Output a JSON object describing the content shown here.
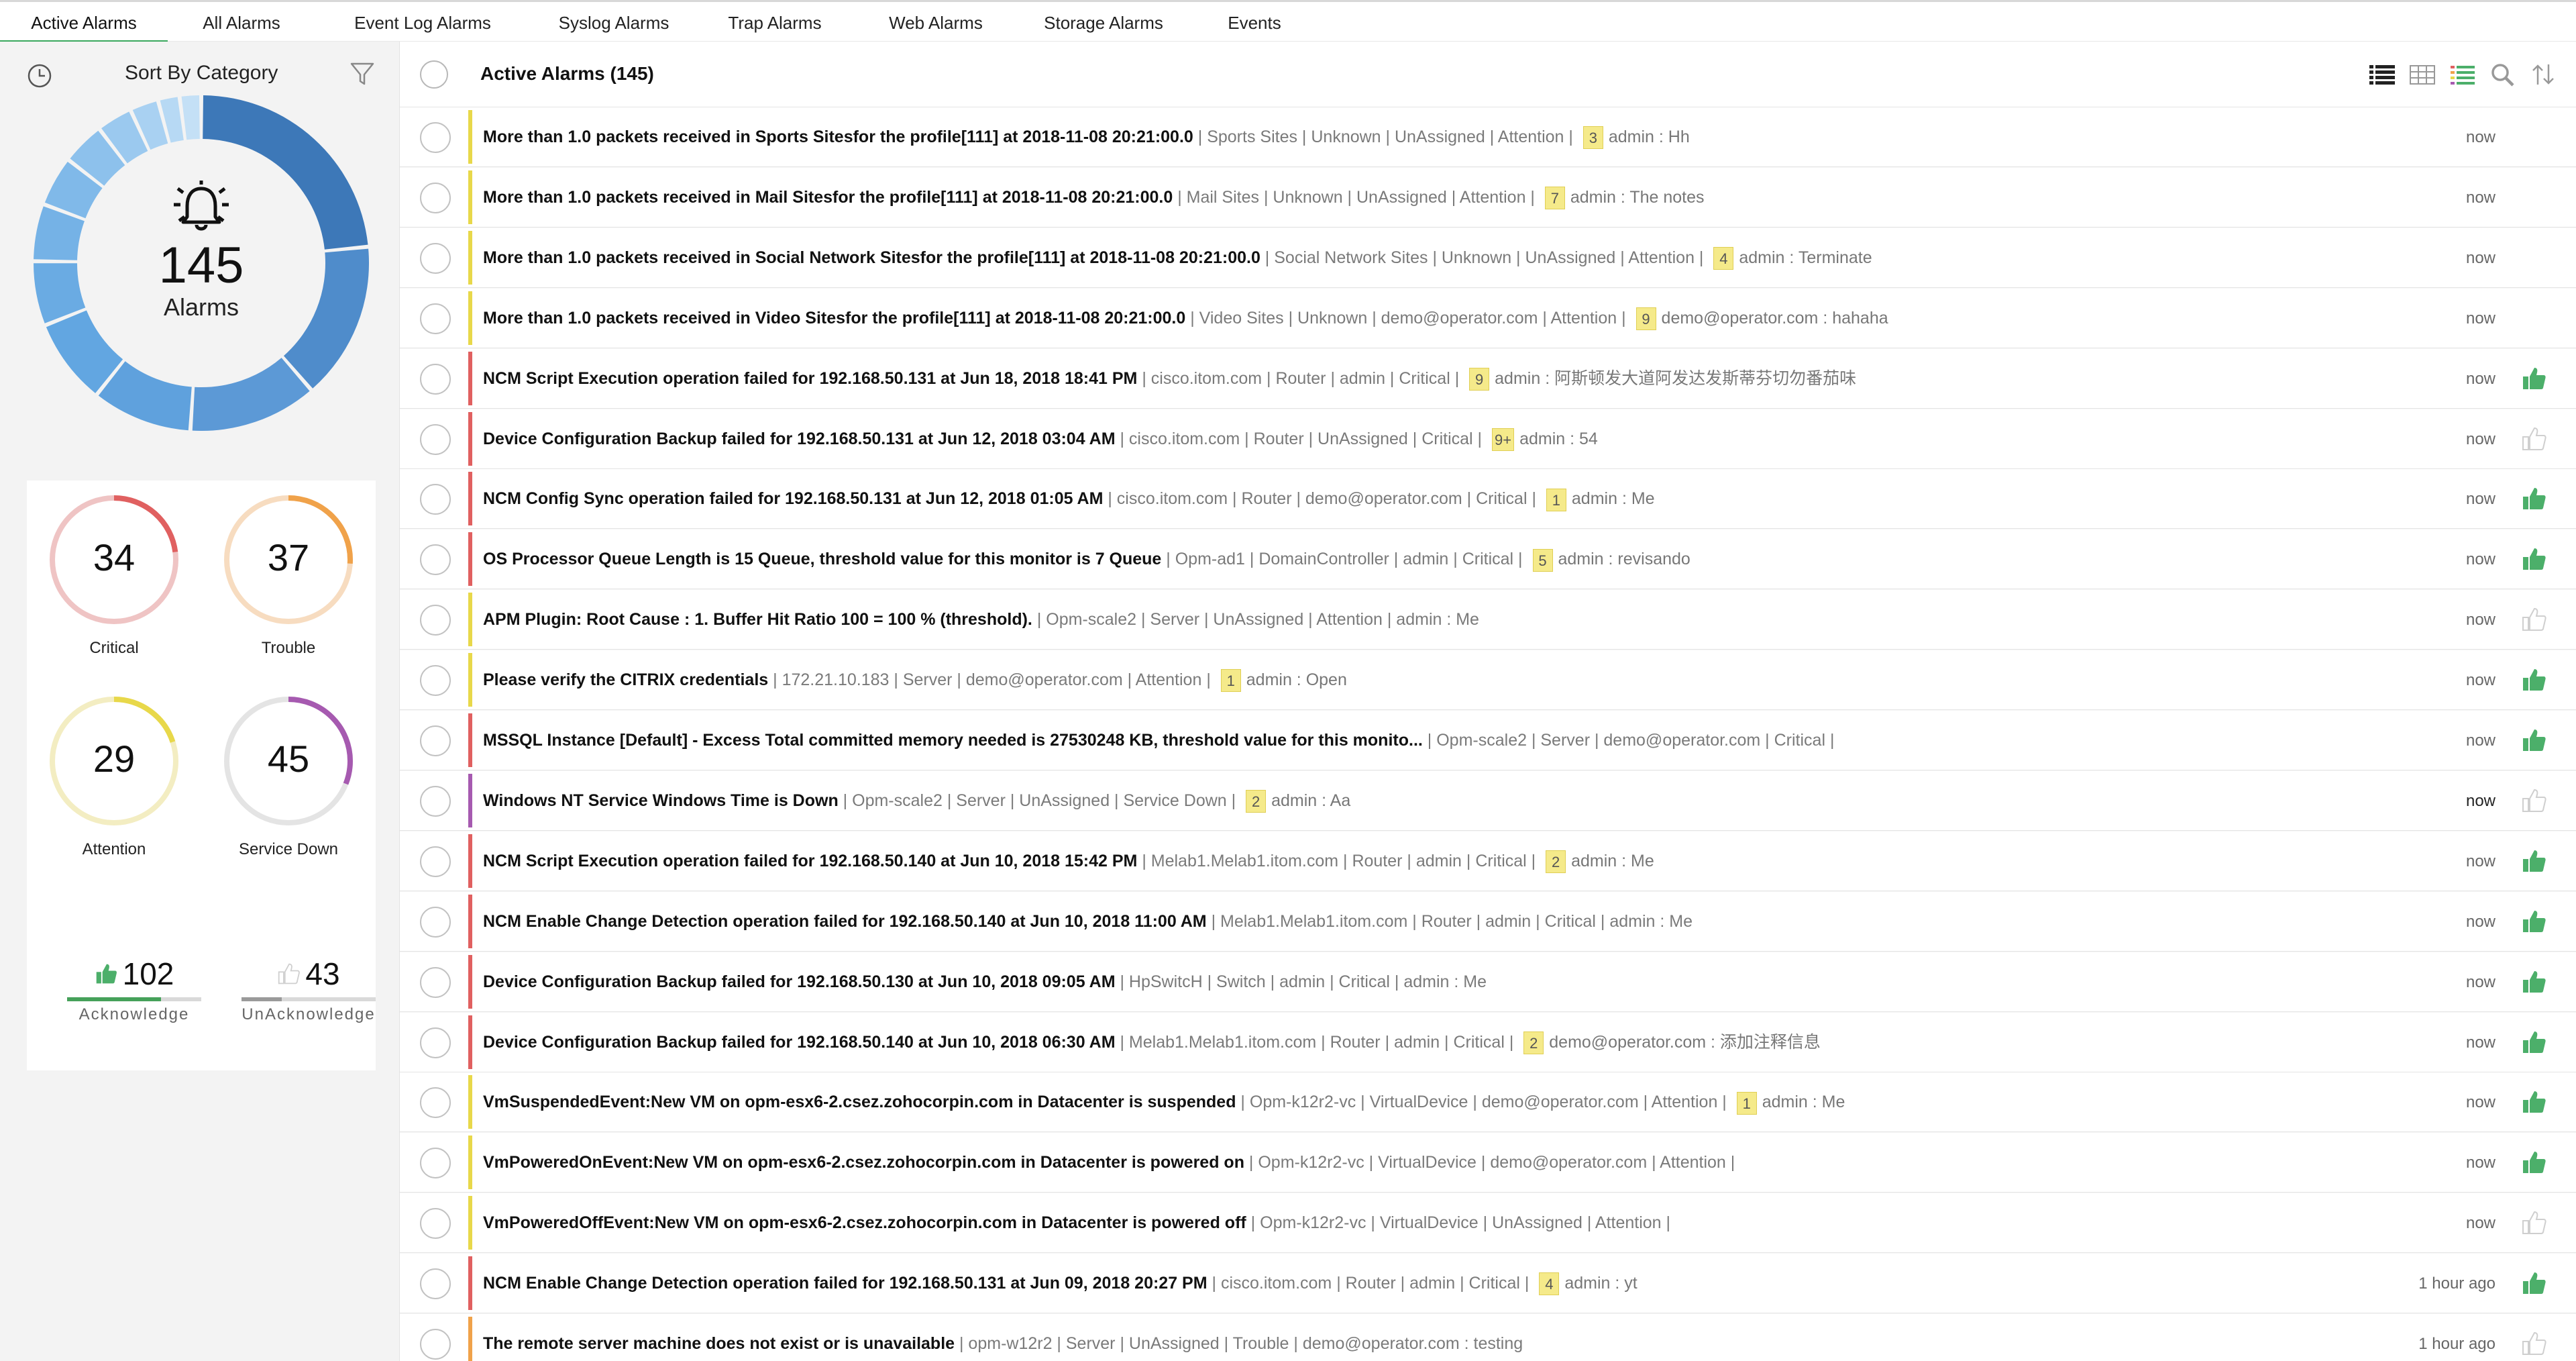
{
  "tabs": [
    {
      "label": "Active Alarms",
      "active": true
    },
    {
      "label": "All Alarms",
      "active": false
    },
    {
      "label": "Event Log Alarms",
      "active": false
    },
    {
      "label": "Syslog Alarms",
      "active": false
    },
    {
      "label": "Trap Alarms",
      "active": false
    },
    {
      "label": "Web Alarms",
      "active": false
    },
    {
      "label": "Storage Alarms",
      "active": false
    },
    {
      "label": "Events",
      "active": false
    }
  ],
  "sidebar": {
    "sort_label": "Sort By Category",
    "total": {
      "count": "145",
      "label": "Alarms"
    },
    "severities": [
      {
        "count": "34",
        "label": "Critical",
        "color": "#e06060",
        "track": "#efc4c4",
        "fill_fraction": 0.23
      },
      {
        "count": "37",
        "label": "Trouble",
        "color": "#f0a24a",
        "track": "#f7dcc0",
        "fill_fraction": 0.26
      },
      {
        "count": "29",
        "label": "Attention",
        "color": "#e8d84a",
        "track": "#f3edc2",
        "fill_fraction": 0.2
      },
      {
        "count": "45",
        "label": "Service Down",
        "color": "#a65ab0",
        "track": "#e4e4e4",
        "fill_fraction": 0.31
      }
    ],
    "acknowledge": {
      "count": "102",
      "label": "Acknowledge",
      "fraction": 0.7
    },
    "unacknowledge": {
      "count": "43",
      "label": "UnAcknowledge",
      "fraction": 0.3
    }
  },
  "colors": {
    "critical": "#e06060",
    "trouble": "#f0a24a",
    "attention": "#e8d84a",
    "service_down": "#a65ab0",
    "accent_green": "#3aa85e",
    "ack_thumb": "#4caf6a",
    "unack_thumb": "#cfcfcf"
  },
  "main": {
    "title": "Active Alarms (145)",
    "header_icons": [
      "list-view-icon",
      "grid-view-icon",
      "detail-list-icon",
      "search-icon",
      "sort-icon"
    ]
  },
  "alarms": [
    {
      "message": "More than 1.0 packets received in Sports Sitesfor the profile[111] at 2018-11-08 20:21:00.0",
      "meta": " | Sports Sites | Unknown | UnAssigned | Attention | ",
      "badge": "3",
      "note": "admin : Hh",
      "time": "now",
      "severity": "attention",
      "ack": "none"
    },
    {
      "message": "More than 1.0 packets received in Mail Sitesfor the profile[111] at 2018-11-08 20:21:00.0",
      "meta": " | Mail Sites | Unknown | UnAssigned | Attention | ",
      "badge": "7",
      "note": "admin : The notes",
      "time": "now",
      "severity": "attention",
      "ack": "none"
    },
    {
      "message": "More than 1.0 packets received in Social Network Sitesfor the profile[111] at 2018-11-08 20:21:00.0",
      "meta": " | Social Network Sites | Unknown | UnAssigned | Attention | ",
      "badge": "4",
      "note": "admin : Terminate",
      "time": "now",
      "severity": "attention",
      "ack": "none"
    },
    {
      "message": "More than 1.0 packets received in Video Sitesfor the profile[111] at 2018-11-08 20:21:00.0",
      "meta": " | Video Sites | Unknown | demo@operator.com | Attention | ",
      "badge": "9",
      "note": "demo@operator.com : hahaha",
      "time": "now",
      "severity": "attention",
      "ack": "none"
    },
    {
      "message": "NCM Script Execution operation failed for 192.168.50.131 at Jun 18, 2018 18:41 PM",
      "meta": " | cisco.itom.com | Router | admin | Critical | ",
      "badge": "9",
      "note": "admin : 阿斯顿发大道阿发达发斯蒂芬切勿番茄味",
      "time": "now",
      "severity": "critical",
      "ack": "ack"
    },
    {
      "message": "Device Configuration Backup failed for 192.168.50.131 at Jun 12, 2018 03:04 AM",
      "meta": " | cisco.itom.com | Router | UnAssigned | Critical | ",
      "badge": "9+",
      "note": "admin : 54",
      "time": "now",
      "severity": "critical",
      "ack": "unack"
    },
    {
      "message": "NCM Config Sync operation failed for 192.168.50.131 at Jun 12, 2018 01:05 AM",
      "meta": " | cisco.itom.com | Router | demo@operator.com | Critical | ",
      "badge": "1",
      "note": "admin : Me",
      "time": "now",
      "severity": "critical",
      "ack": "ack"
    },
    {
      "message": "OS Processor Queue Length is 15 Queue, threshold value for this monitor is 7 Queue",
      "meta": " | Opm-ad1 | DomainController | admin | Critical | ",
      "badge": "5",
      "note": "admin : revisando",
      "time": "now",
      "severity": "critical",
      "ack": "ack"
    },
    {
      "message": "APM Plugin: Root Cause : 1. Buffer Hit Ratio 100 = 100 % (threshold).",
      "meta": " | Opm-scale2 | Server | UnAssigned | Attention | admin : Me",
      "badge": "",
      "note": "",
      "time": "now",
      "severity": "attention",
      "ack": "unack"
    },
    {
      "message": "Please verify the CITRIX credentials",
      "meta": " | 172.21.10.183 | Server | demo@operator.com | Attention | ",
      "badge": "1",
      "note": "admin : Open",
      "time": "now",
      "severity": "attention",
      "ack": "ack"
    },
    {
      "message": "MSSQL Instance [Default] - Excess Total committed memory needed is 27530248 KB, threshold value for this monito...",
      "meta": "  | Opm-scale2 | Server | demo@operator.com | Critical |",
      "badge": "",
      "note": "",
      "time": "now",
      "severity": "critical",
      "ack": "ack"
    },
    {
      "message": "Windows NT Service Windows Time is Down",
      "meta": " | Opm-scale2 | Server | UnAssigned | Service Down | ",
      "badge": "2",
      "note": "admin : Aa",
      "time": "now",
      "severity": "service_down",
      "ack": "unack",
      "strong": true
    },
    {
      "message": "NCM Script Execution operation failed for 192.168.50.140 at Jun 10, 2018 15:42 PM",
      "meta": " | Melab1.Melab1.itom.com | Router | admin | Critical | ",
      "badge": "2",
      "note": "admin : Me",
      "time": "now",
      "severity": "critical",
      "ack": "ack"
    },
    {
      "message": "NCM Enable Change Detection operation failed for 192.168.50.140 at Jun 10, 2018 11:00 AM",
      "meta": " | Melab1.Melab1.itom.com | Router | admin | Critical | admin : Me",
      "badge": "",
      "note": "",
      "time": "now",
      "severity": "critical",
      "ack": "ack"
    },
    {
      "message": "Device Configuration Backup failed for 192.168.50.130 at Jun 10, 2018 09:05 AM",
      "meta": " | HpSwitcH | Switch | admin | Critical | admin : Me",
      "badge": "",
      "note": "",
      "time": "now",
      "severity": "critical",
      "ack": "ack"
    },
    {
      "message": "Device Configuration Backup failed for 192.168.50.140 at Jun 10, 2018 06:30 AM",
      "meta": " | Melab1.Melab1.itom.com | Router | admin | Critical | ",
      "badge": "2",
      "note": "demo@operator.com : 添加注释信息",
      "time": "now",
      "severity": "critical",
      "ack": "ack"
    },
    {
      "message": "VmSuspendedEvent:New VM on opm-esx6-2.csez.zohocorpin.com in Datacenter is suspended",
      "meta": " | Opm-k12r2-vc | VirtualDevice | demo@operator.com | Attention | ",
      "badge": "1",
      "note": "admin : Me",
      "time": "now",
      "severity": "attention",
      "ack": "ack"
    },
    {
      "message": "VmPoweredOnEvent:New VM on opm-esx6-2.csez.zohocorpin.com in Datacenter is powered on",
      "meta": " | Opm-k12r2-vc | VirtualDevice | demo@operator.com | Attention |",
      "badge": "",
      "note": "",
      "time": "now",
      "severity": "attention",
      "ack": "ack"
    },
    {
      "message": "VmPoweredOffEvent:New VM on opm-esx6-2.csez.zohocorpin.com in Datacenter is powered off",
      "meta": " | Opm-k12r2-vc | VirtualDevice | UnAssigned | Attention |",
      "badge": "",
      "note": "",
      "time": "now",
      "severity": "attention",
      "ack": "unack"
    },
    {
      "message": "NCM Enable Change Detection operation failed for 192.168.50.131 at Jun 09, 2018 20:27 PM",
      "meta": " | cisco.itom.com | Router | admin | Critical | ",
      "badge": "4",
      "note": "admin : yt",
      "time": "1 hour ago",
      "severity": "critical",
      "ack": "ack"
    },
    {
      "message": "The remote server machine does not exist or is unavailable",
      "meta": " | opm-w12r2 | Server | UnAssigned | Trouble | demo@operator.com : testing",
      "badge": "",
      "note": "",
      "time": "1 hour ago",
      "severity": "trouble",
      "ack": "unack"
    }
  ]
}
